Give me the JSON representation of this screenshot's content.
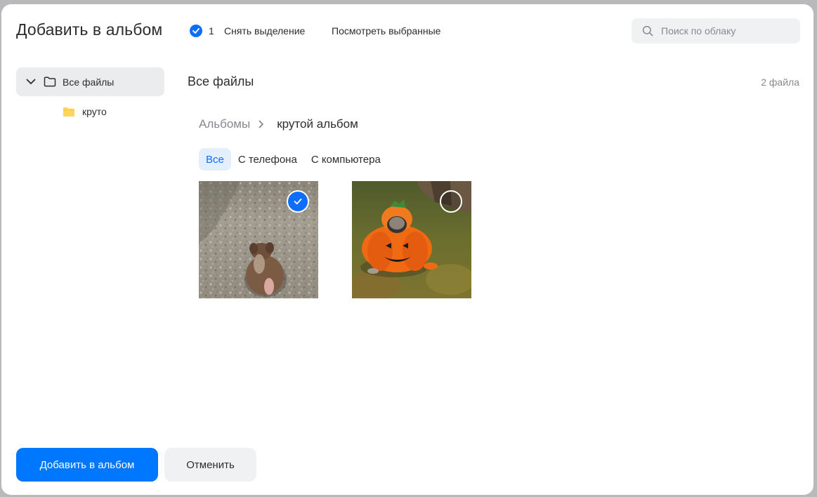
{
  "header": {
    "title": "Добавить в альбом",
    "selected_count": "1",
    "deselect_label": "Снять выделение",
    "view_selected_label": "Посмотреть выбранные"
  },
  "search": {
    "placeholder": "Поиск по облаку",
    "value": ""
  },
  "sidebar": {
    "root_label": "Все файлы",
    "children": [
      {
        "label": "круто"
      }
    ]
  },
  "main": {
    "title": "Все файлы",
    "file_count": "2 файла",
    "breadcrumb": {
      "parent": "Альбомы",
      "current": "крутой альбом"
    },
    "tabs": [
      {
        "label": "Все",
        "active": true
      },
      {
        "label": "С телефона",
        "active": false
      },
      {
        "label": "С компьютера",
        "active": false
      }
    ],
    "items": [
      {
        "name": "dog-on-gravel-photo",
        "selected": true
      },
      {
        "name": "pug-pumpkin-costume-photo",
        "selected": false
      }
    ]
  },
  "footer": {
    "add_label": "Добавить в альбом",
    "cancel_label": "Отменить"
  },
  "colors": {
    "accent": "#0077ff",
    "check": "#0d6efd",
    "tab_active_bg": "#e4effd",
    "folder": "#ffd65c"
  },
  "icons": [
    "check-icon",
    "search-icon",
    "chevron-down-icon",
    "folder-outline-icon",
    "folder-icon",
    "chevron-right-icon"
  ]
}
